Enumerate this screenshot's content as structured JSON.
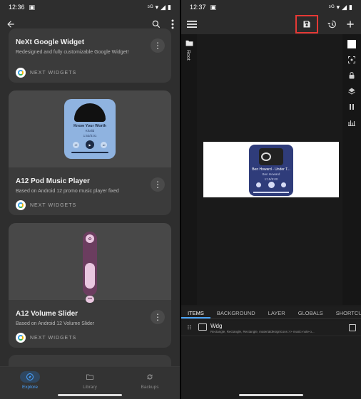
{
  "left": {
    "status_time": "12:36",
    "cards": [
      {
        "title": "NeXt Google Widget",
        "desc": "Redesigned and fully customizable Google Widget!",
        "brand": "NEXT WIDGETS"
      },
      {
        "title": "A12 Pod Music Player",
        "desc": "Based on Android 12 promo music player fixed",
        "brand": "NEXT WIDGETS",
        "preview": {
          "song": "Know Your Worth",
          "artist": "Khalid",
          "time": "1:53/3:01"
        }
      },
      {
        "title": "A12 Volume Slider",
        "desc": "Based on Android 12 Volume Slider",
        "brand": "NEXT WIDGETS"
      }
    ],
    "nav": [
      {
        "label": "Explore",
        "icon": "compass-icon"
      },
      {
        "label": "Library",
        "icon": "folder-icon"
      },
      {
        "label": "Backups",
        "icon": "sync-icon"
      }
    ]
  },
  "right": {
    "status_time": "12:37",
    "rail_label": "Root",
    "preview": {
      "song": "Ben Howard - Under T...",
      "artist": "Ben Howard",
      "time": "1:15/5:00"
    },
    "tabs": [
      "ITEMS",
      "BACKGROUND",
      "LAYER",
      "GLOBALS",
      "SHORTCU"
    ],
    "layer": {
      "name": "Wdg",
      "sub": "Rectangle, Rectangle, Rectangle, materialdesignicons >> music-note-o..."
    }
  },
  "colors": {
    "accent": "#4aa3ff",
    "highlight": "#e53935"
  }
}
